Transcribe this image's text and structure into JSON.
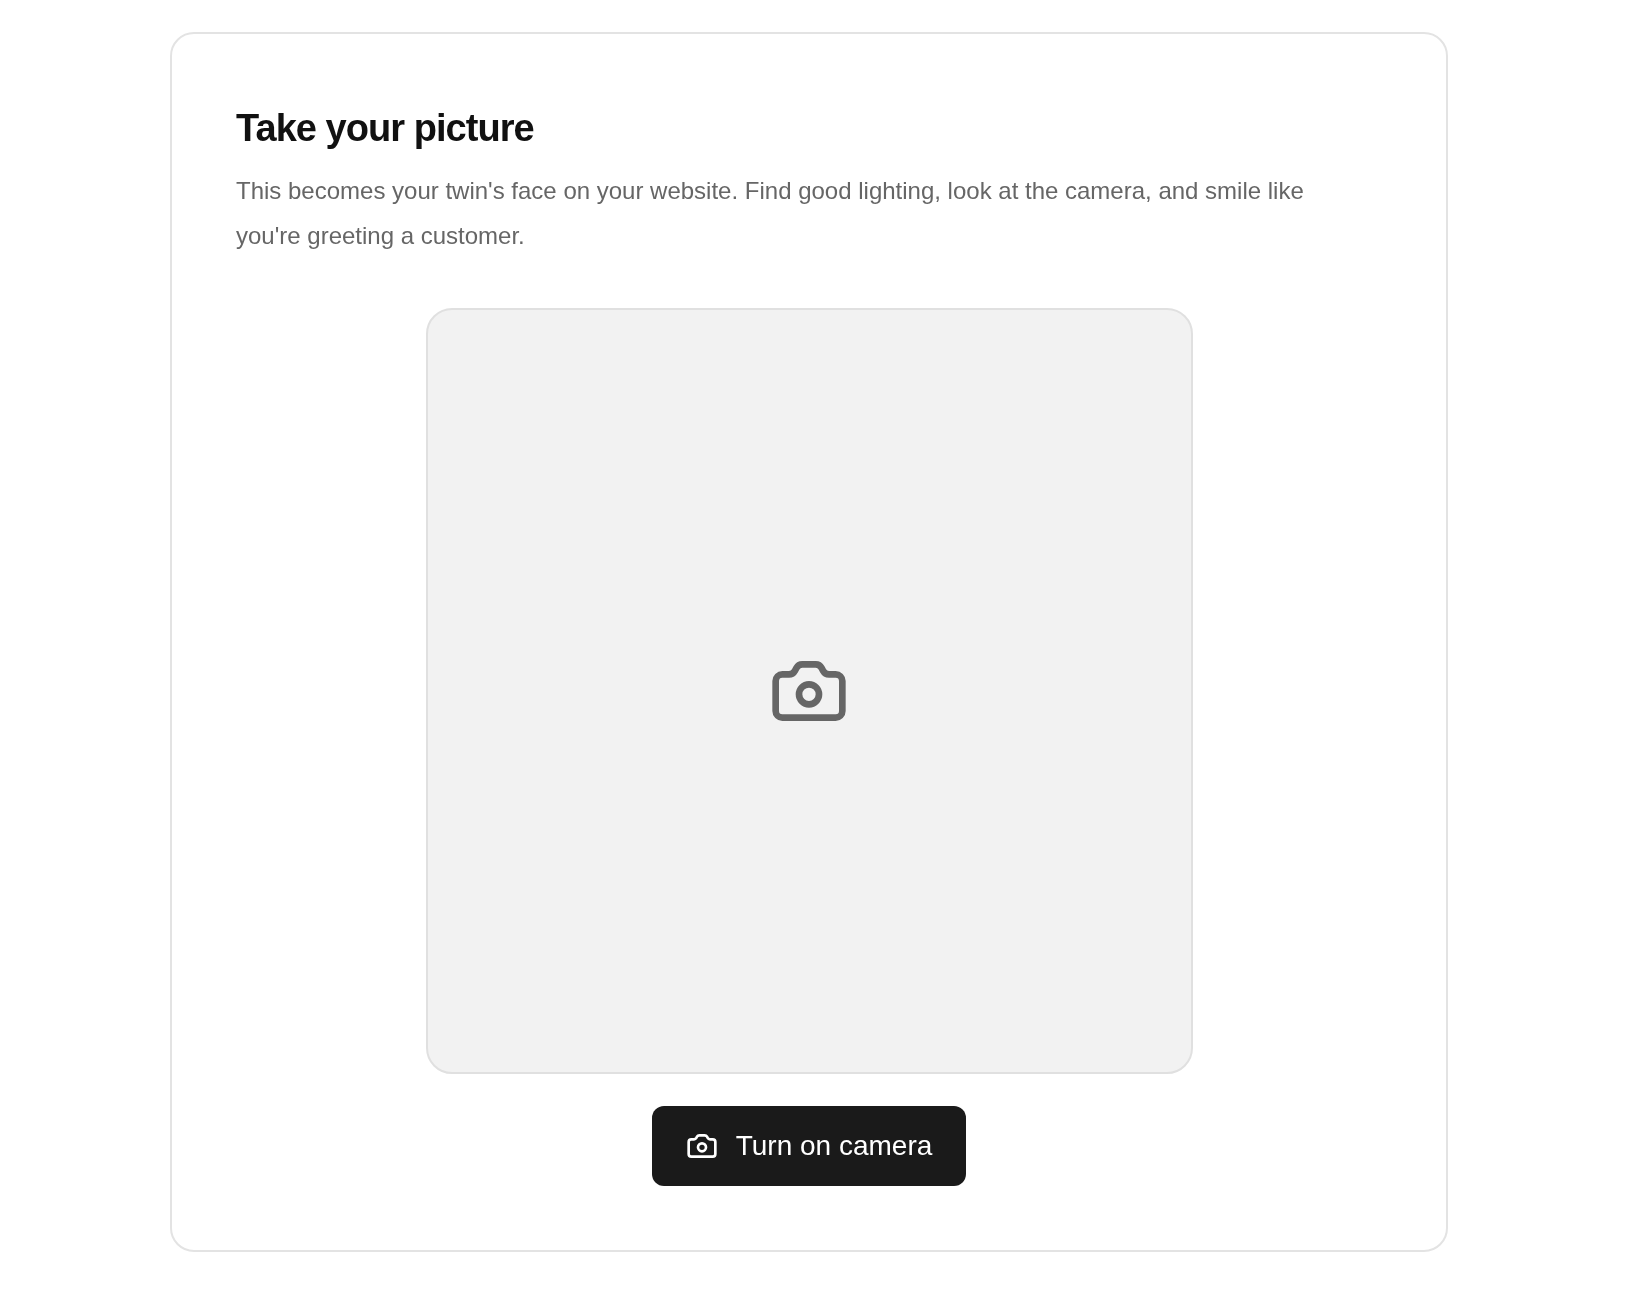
{
  "title": "Take your picture",
  "description": "This becomes your twin's face on your website. Find good lighting, look at the camera, and smile like you're greeting a customer.",
  "camera_button": {
    "label": "Turn on camera"
  }
}
